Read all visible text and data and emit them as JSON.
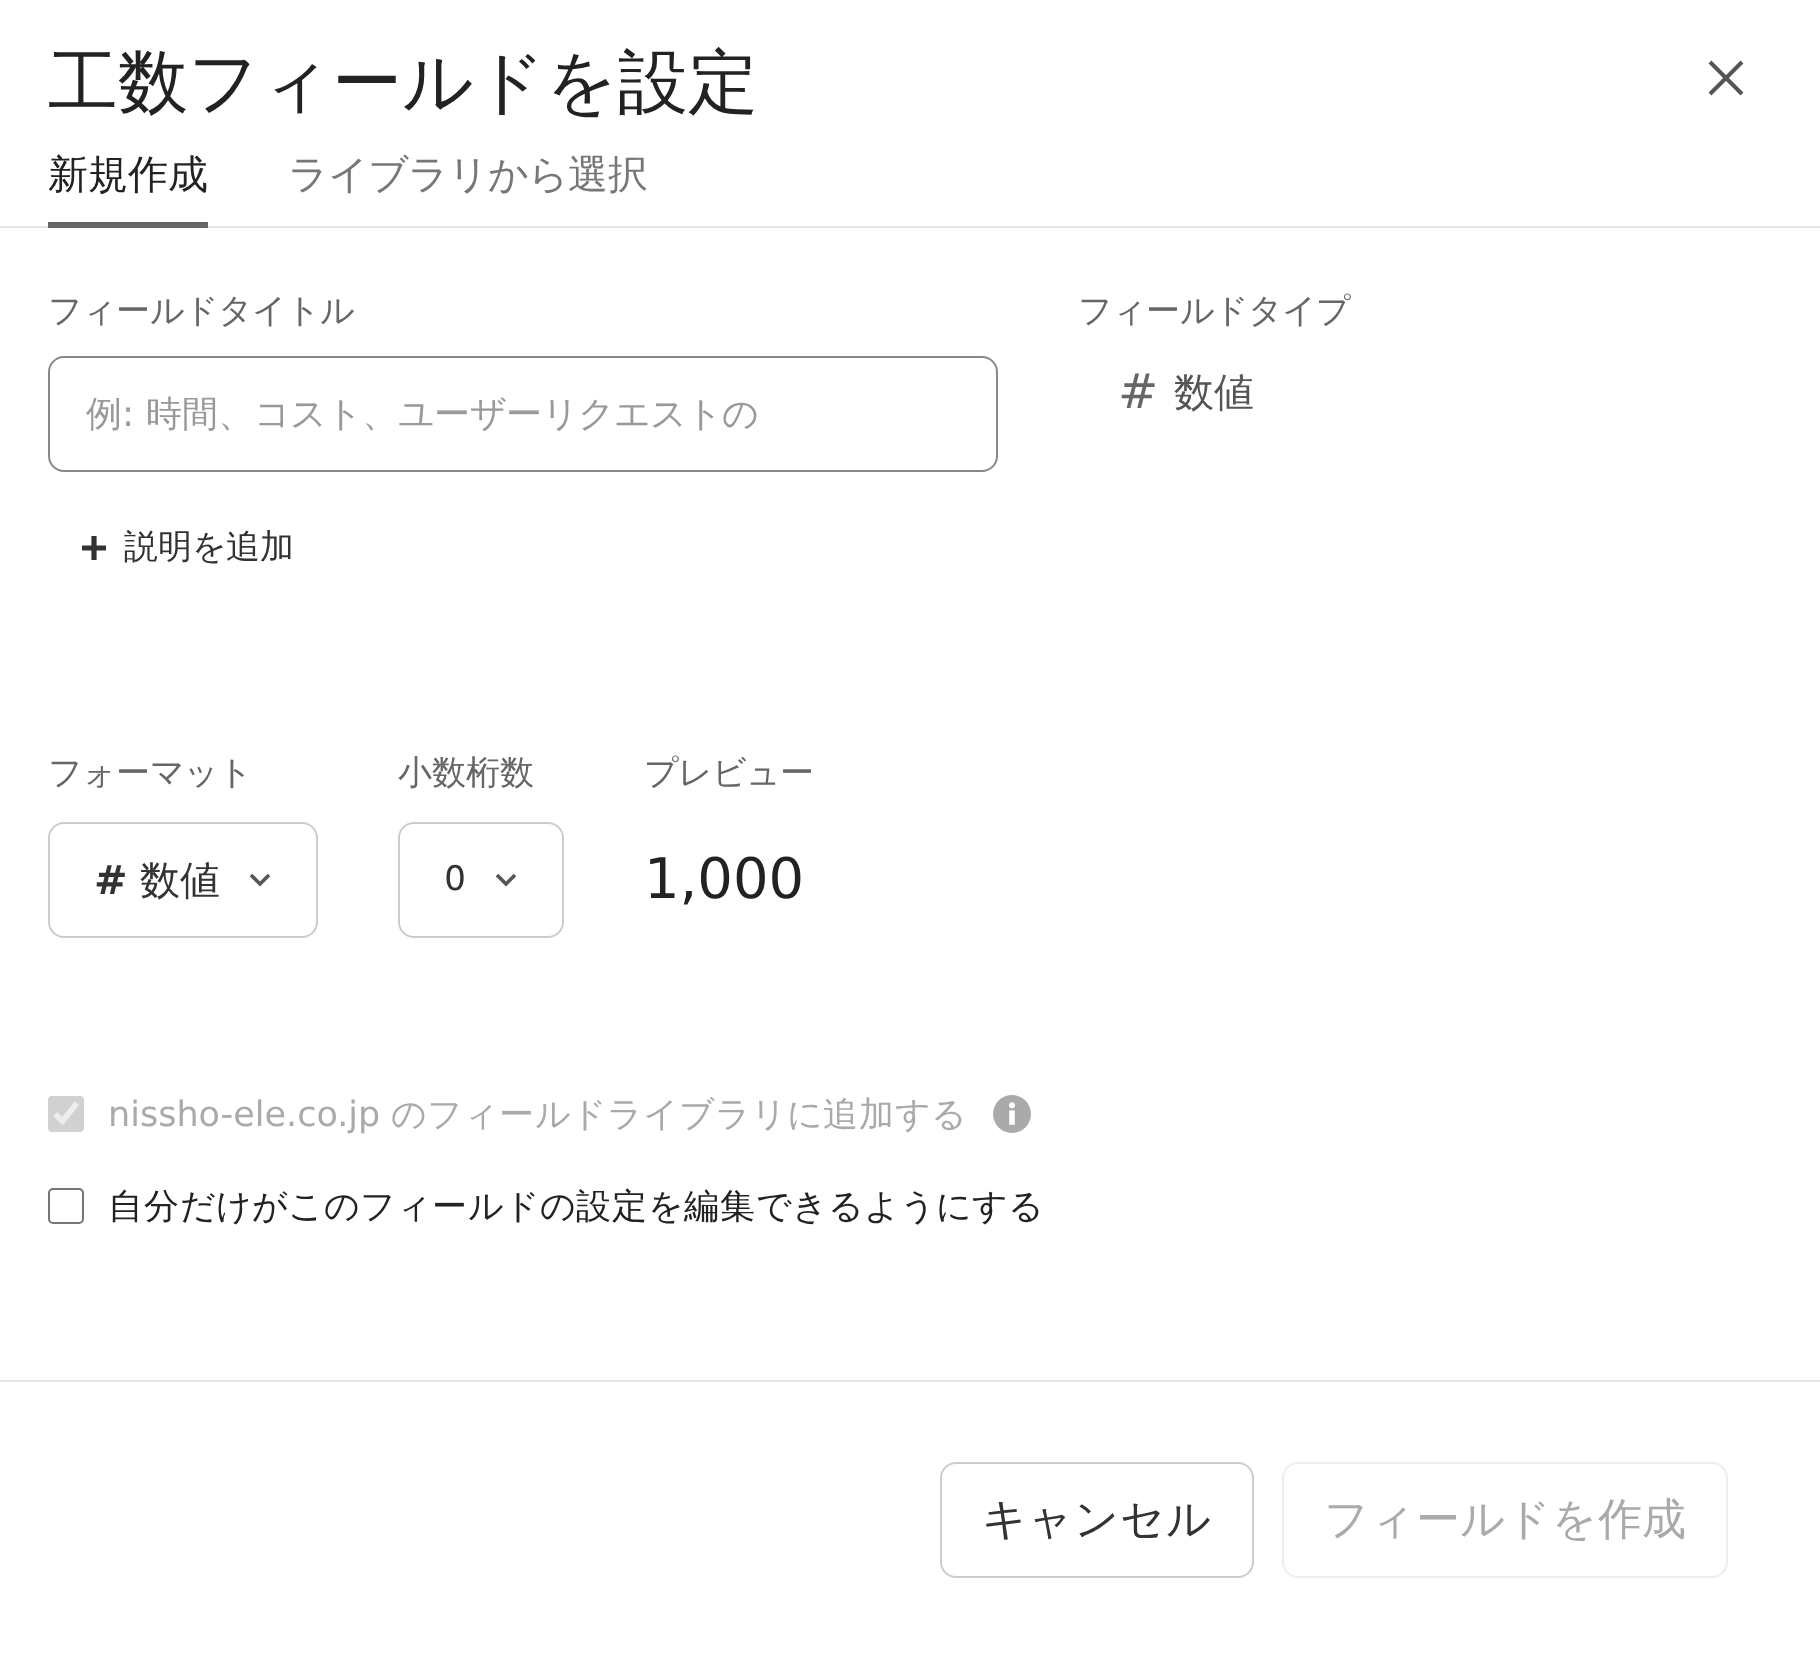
{
  "dialog": {
    "title": "工数フィールドを設定"
  },
  "tabs": [
    {
      "label": "新規作成",
      "selected": true
    },
    {
      "label": "ライブラリから選択",
      "selected": false
    }
  ],
  "field_title": {
    "label": "フィールドタイトル",
    "placeholder": "例: 時間、コスト、ユーザーリクエストの"
  },
  "field_type": {
    "label": "フィールドタイプ",
    "symbol": "#",
    "value": "数値"
  },
  "add_description": {
    "label": "説明を追加"
  },
  "format": {
    "label": "フォーマット",
    "value": "**#** 数値"
  },
  "decimals": {
    "label": "小数桁数",
    "value": "0"
  },
  "preview": {
    "label": "プレビュー",
    "value": "1,000"
  },
  "options": [
    {
      "label": "nissho-ele.co.jp のフィールドライブラリに追加する",
      "checked": true,
      "disabled": true,
      "info": true
    },
    {
      "label": "自分だけがこのフィールドの設定を編集できるようにする",
      "checked": false,
      "disabled": false,
      "info": false
    }
  ],
  "buttons": [
    {
      "label": "キャンセル",
      "disabled": false
    },
    {
      "label": "フィールドを作成",
      "disabled": true
    }
  ]
}
